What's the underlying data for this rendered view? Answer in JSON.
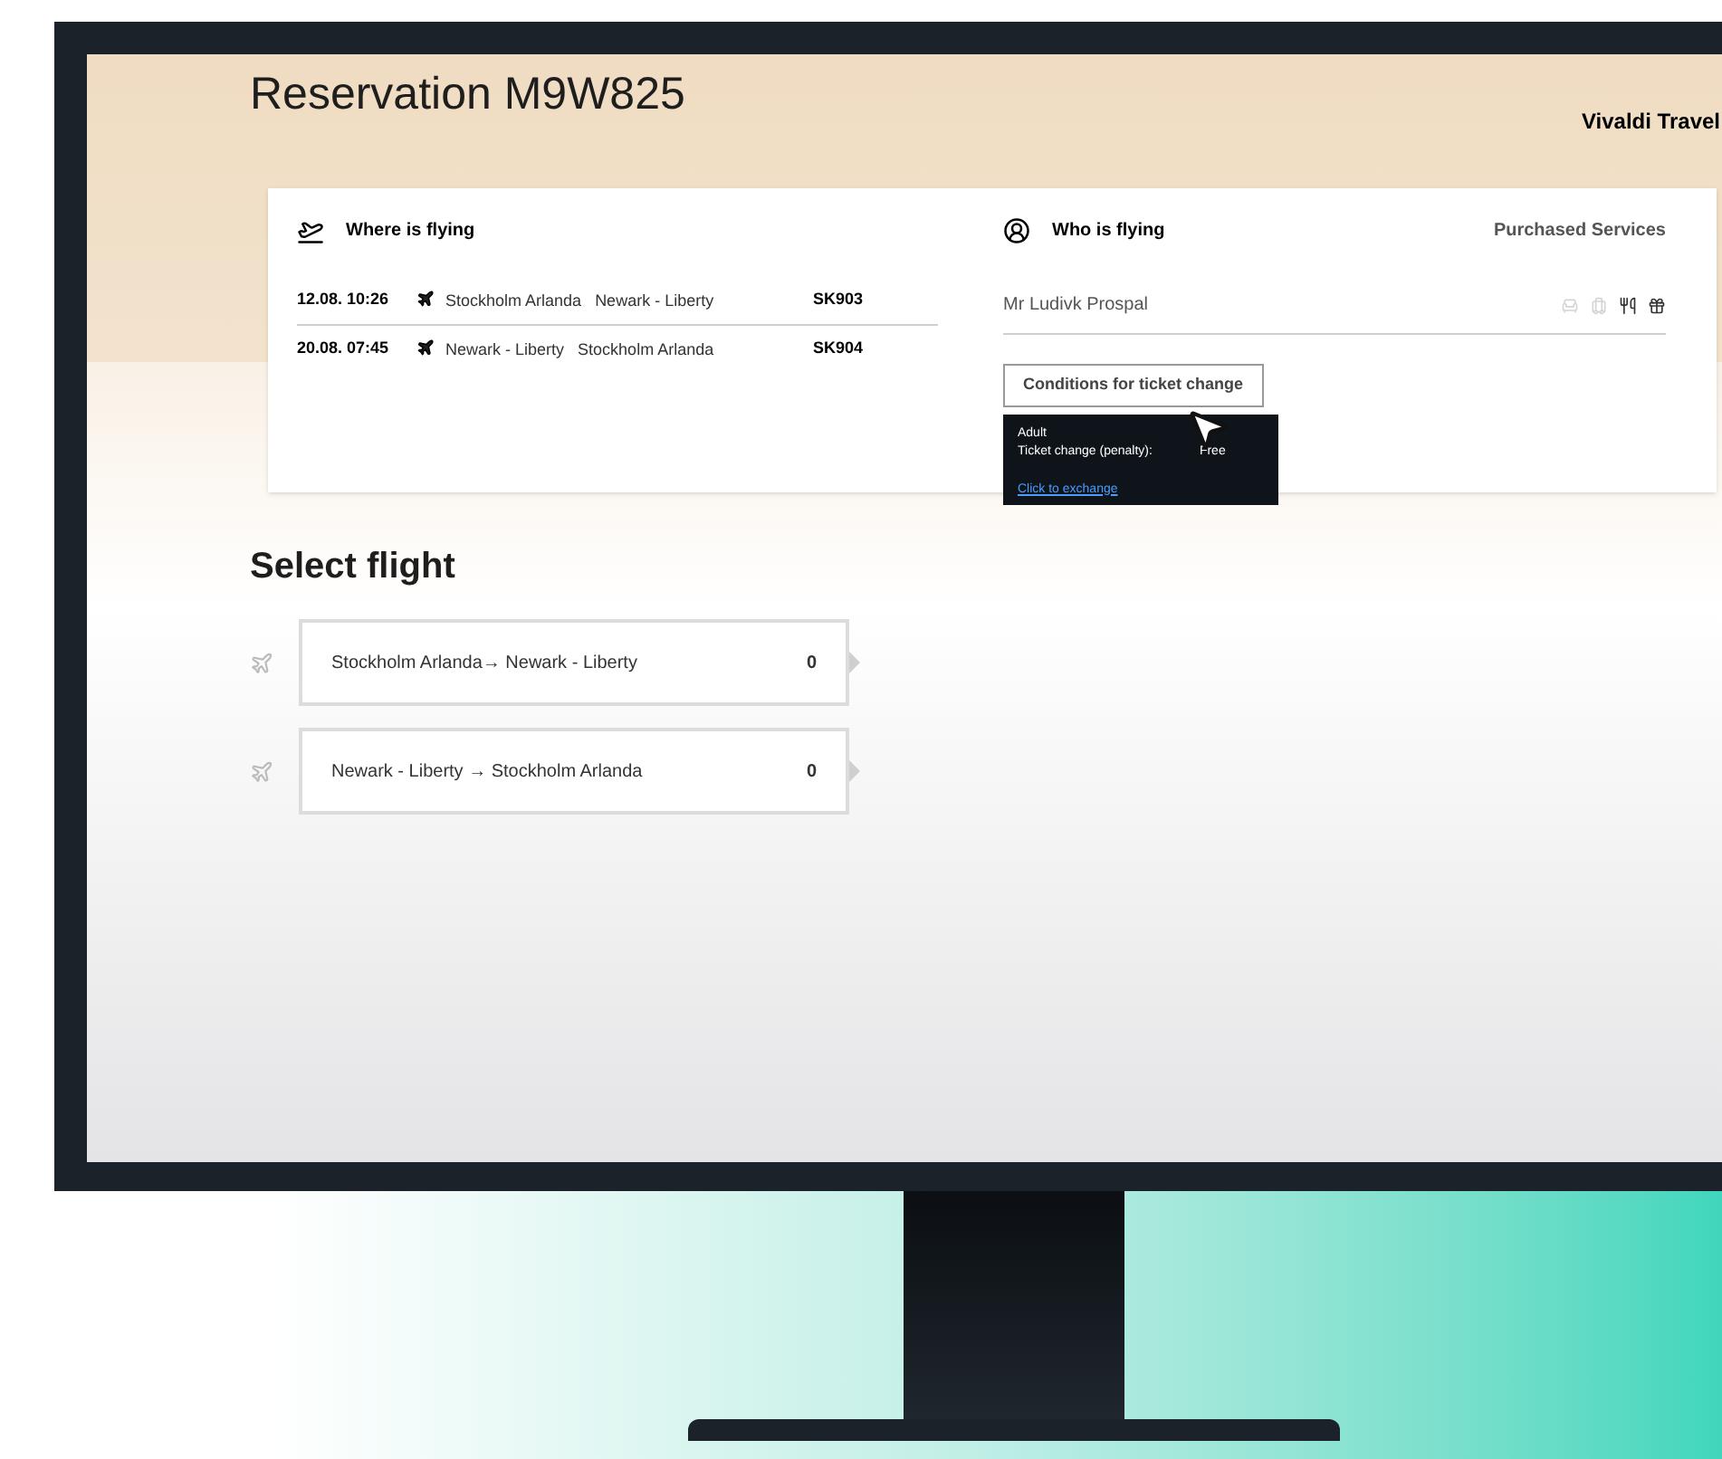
{
  "header": {
    "title": "Reservation M9W825",
    "brand": "Vivaldi Travel"
  },
  "flights_panel": {
    "heading": "Where is flying",
    "rows": [
      {
        "datetime": "12.08. 10:26",
        "from": "Stockholm Arlanda",
        "to": "Newark - Liberty",
        "flight": "SK903"
      },
      {
        "datetime": "20.08. 07:45",
        "from": "Newark - Liberty",
        "to": "Stockholm Arlanda",
        "flight": "SK904"
      }
    ]
  },
  "passengers_panel": {
    "heading": "Who is flying",
    "services_heading": "Purchased Services",
    "passenger": "Mr Ludivk Prospal",
    "services": [
      {
        "kind": "seat",
        "purchased": false
      },
      {
        "kind": "baggage",
        "purchased": false
      },
      {
        "kind": "meal",
        "purchased": true
      },
      {
        "kind": "gift",
        "purchased": true
      }
    ],
    "conditions_button": "Conditions for ticket change",
    "tooltip": {
      "category": "Adult",
      "label": "Ticket change (penalty):",
      "value": "Free",
      "link": "Click to exchange"
    }
  },
  "select_flight": {
    "heading": "Select flight",
    "options": [
      {
        "route": "Stockholm Arlanda→ Newark - Liberty",
        "count": "0"
      },
      {
        "route": "Newark - Liberty → Stockholm Arlanda",
        "count": "0"
      }
    ]
  }
}
